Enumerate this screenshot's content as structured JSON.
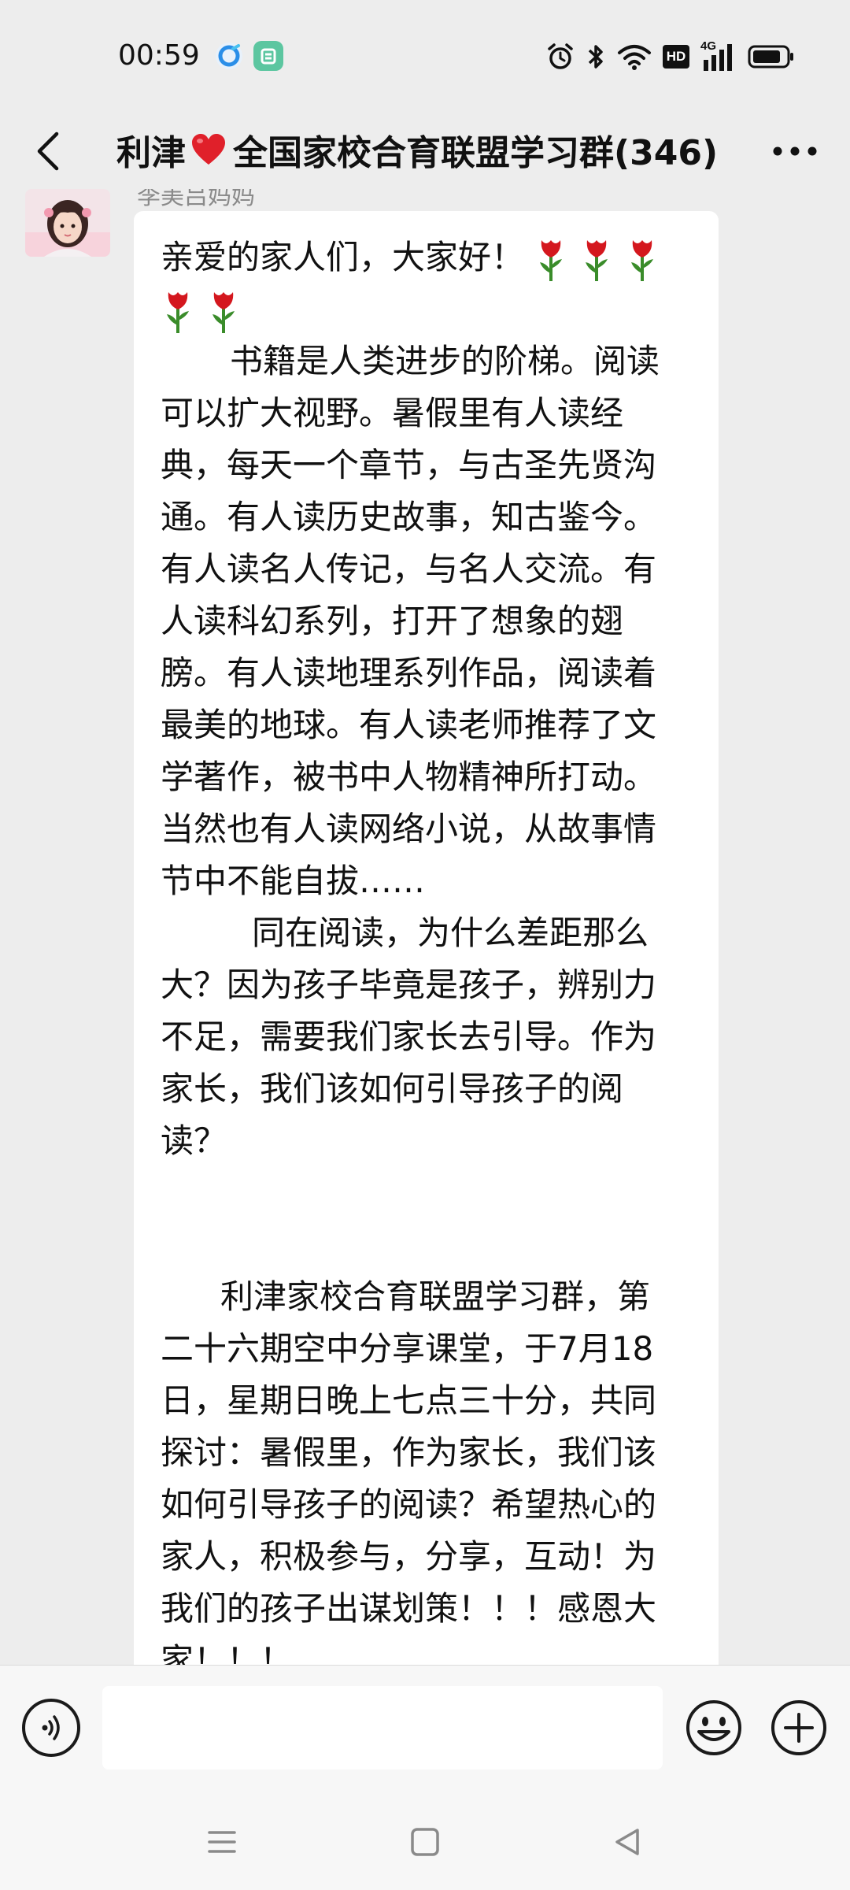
{
  "status_bar": {
    "time": "00:59",
    "icons": [
      "browser-notification-icon",
      "app-notification-icon",
      "alarm-icon",
      "bluetooth-icon",
      "wifi-icon",
      "hd-icon",
      "signal-4g-icon",
      "battery-icon"
    ],
    "hd_label": "HD",
    "network_label": "4G"
  },
  "header": {
    "title_prefix": "利津",
    "title_emoji": "❤️",
    "title_main": "全国家校合育联盟学习群(346)",
    "back_icon": "chevron-left-icon",
    "more_icon": "more-dots-icon"
  },
  "chat": {
    "sender_name": "李美吕妈妈",
    "message_lines": [
      "亲爱的家人们，大家好！",
      "",
      "书籍是人类进步的阶梯。阅读",
      "可以扩大视野。暑假里有人读经",
      "典，每天一个章节，与古圣先贤沟",
      "通。有人读历史故事，知古鉴今。",
      "有人读名人传记，与名人交流。有",
      "人读科幻系列，打开了想象的翅",
      "膀。有人读地理系列作品，阅读着",
      "最美的地球。有人读老师推荐了文",
      "学著作，被书中人物精神所打动。",
      "当然也有人读网络小说，从故事情",
      "节中不能自拔……",
      "同在阅读，为什么差距那么",
      "大？因为孩子毕竟是孩子，辨别力",
      "不足，需要我们家长去引导。作为",
      "家长，我们该如何引导孩子的阅",
      "读？",
      "",
      "",
      "利津家校合育联盟学习群，第",
      "二十六期空中分享课堂，于7月18",
      "日，星期日晚上七点三十分，共同",
      "探讨：暑假里，作为家长，我们该",
      "如何引导孩子的阅读？希望热心的",
      "家人，积极参与，分享，互动！为",
      "我们的孩子出谋划策！！！感恩大",
      "家！！！"
    ],
    "emoji_icons": [
      "tulip-icon",
      "tulip-icon",
      "tulip-icon",
      "tulip-icon",
      "tulip-icon"
    ]
  },
  "input_bar": {
    "placeholder": "",
    "value": "",
    "voice_icon": "voice-icon",
    "emoji_icon": "smiley-icon",
    "plus_icon": "plus-icon"
  },
  "nav_bar": {
    "icons": [
      "menu-icon",
      "home-icon",
      "back-triangle-icon"
    ]
  },
  "colors": {
    "background": "#ededed",
    "bubble": "#ffffff",
    "text": "#111111",
    "muted": "#8a8a8a",
    "heart": "#e0202a",
    "tulip_red": "#d4171e",
    "tulip_green": "#3a8c2a"
  }
}
